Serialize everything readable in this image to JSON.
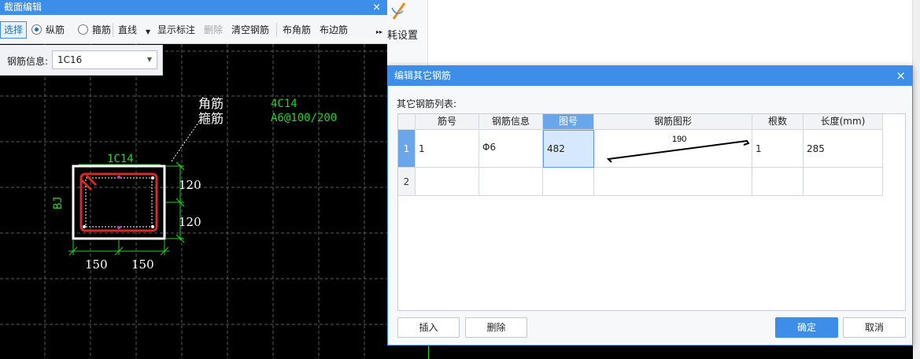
{
  "section_editor": {
    "title": "截面编辑",
    "close_label": "×",
    "toolbar": {
      "select": "选择",
      "longitudinal": "纵筋",
      "stirrup": "箍筋",
      "line_mode": "直线",
      "show_label": "显示标注",
      "delete": "删除",
      "clear_rebar": "清空钢筋",
      "corner_bar": "布角筋",
      "edge_bar": "布边筋",
      "more": "▸▸"
    },
    "rebar_info_label": "钢筋信息:",
    "rebar_info_value": "1C16",
    "drawing": {
      "corner_label": "角筋",
      "stirrup_label": "箍筋",
      "corner_value": "4C14",
      "stirrup_value": "A6@100/200",
      "top_label": "1C14",
      "side_label": "BJ",
      "dim_v1": "120",
      "dim_v2": "120",
      "dim_h1": "150",
      "dim_h2": "150"
    }
  },
  "background_app": {
    "ribbon_label": "耗设置"
  },
  "dialog": {
    "title": "编辑其它钢筋",
    "close_label": "×",
    "list_label": "其它钢筋列表:",
    "columns": [
      "筋号",
      "钢筋信息",
      "图号",
      "钢筋图形",
      "根数",
      "长度(mm)"
    ],
    "rows": [
      {
        "index": "1",
        "bar_no": "1",
        "info": "Φ6",
        "shape_no": "482",
        "shape_dim": "190",
        "count": "1",
        "length": "285"
      },
      {
        "index": "2",
        "bar_no": "",
        "info": "",
        "shape_no": "",
        "shape_dim": "",
        "count": "",
        "length": ""
      }
    ],
    "buttons": {
      "insert": "插入",
      "delete": "删除",
      "ok": "确定",
      "cancel": "取消"
    }
  },
  "colors": {
    "accent": "#3d8ee8",
    "canvas_bg": "#000000",
    "rebar_red": "#d42a2a",
    "dim_green": "#1fd51f",
    "label_white": "#ffffff"
  }
}
